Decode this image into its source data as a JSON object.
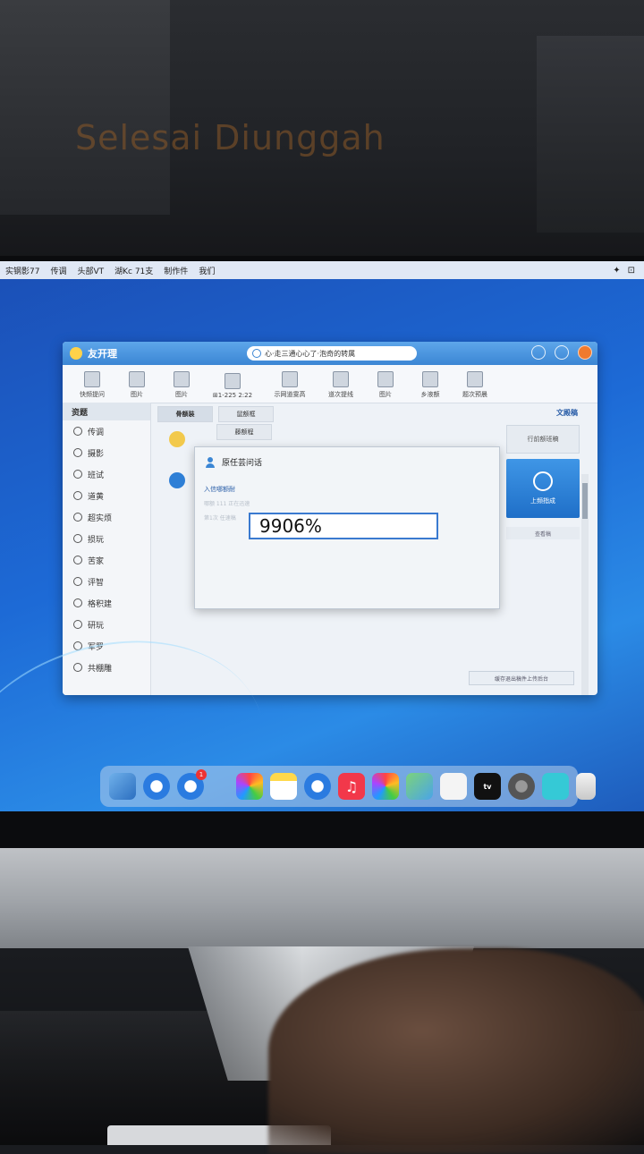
{
  "overlay": {
    "caption": "Selesai Diunggah"
  },
  "menubar": {
    "items": [
      "实钢影77",
      "传调",
      "头部VT",
      "湖Kc 71支",
      "制作件",
      "我们"
    ]
  },
  "window": {
    "app_name": "友开理",
    "search_text": "心·走三通心心了·泡奇的转属",
    "toolbar": [
      "快频提问",
      "图片",
      "图片",
      "⊞1-225 2:22",
      "示网道雯高",
      "道次提线",
      "图片",
      "乡液额",
      "题次预晨"
    ],
    "sidebar": {
      "header": "资题",
      "items": [
        "传调",
        "摄影",
        "班试",
        "道黄",
        "超实烦",
        "损玩",
        "苦家",
        "评智",
        "格积建",
        "研玩",
        "军罗",
        "共棚雕"
      ]
    },
    "tabs": [
      "骨额装",
      "鼠额框"
    ],
    "tabs_secondary": [
      "藤额程"
    ],
    "right_panel": {
      "header": "文殿稿",
      "button1": "行前额班稿",
      "button2": "上频指成",
      "button3": "查看稿"
    },
    "status_button": "缓存退出稿件上传后台",
    "dialog": {
      "title": "原任芸问话",
      "label": "入信哪额耐",
      "faint1": "哪额 111 正在迅速",
      "faint2": "第1次 任速稿",
      "input_value": "9906%"
    }
  },
  "dock": {
    "badge_count": "1",
    "tv_label": "tv"
  },
  "colors": {
    "accent": "#3a7ad0",
    "title_bar": "#3b86d4",
    "desktop": "#1d6ad6"
  }
}
